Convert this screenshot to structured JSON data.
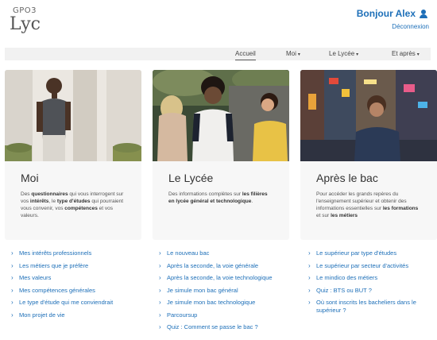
{
  "header": {
    "logo_small": "GPO3",
    "logo_big": "Lyc",
    "greeting": "Bonjour Alex",
    "logout": "Déconnexion"
  },
  "nav": {
    "items": [
      {
        "label": "Accueil",
        "caret": ""
      },
      {
        "label": "Moi",
        "caret": "▾"
      },
      {
        "label": "Le Lycée",
        "caret": "▾"
      },
      {
        "label": "Et après",
        "caret": "▾"
      }
    ]
  },
  "cards": [
    {
      "title": "Moi",
      "desc": [
        {
          "t": "Des ",
          "b": false
        },
        {
          "t": "questionnaires",
          "b": true
        },
        {
          "t": " qui vous interrogent sur vos ",
          "b": false
        },
        {
          "t": "intérêts",
          "b": true
        },
        {
          "t": ", le ",
          "b": false
        },
        {
          "t": "type d'études",
          "b": true
        },
        {
          "t": " qui pourraient vous convenir, vos ",
          "b": false
        },
        {
          "t": "compétences",
          "b": true
        },
        {
          "t": " et vos valeurs.",
          "b": false
        }
      ]
    },
    {
      "title": "Le Lycée",
      "desc": [
        {
          "t": "Des informations complètes sur ",
          "b": false
        },
        {
          "t": "les filières en lycée général et technologique",
          "b": true
        },
        {
          "t": ".",
          "b": false
        }
      ]
    },
    {
      "title": "Après le bac",
      "desc": [
        {
          "t": "Pour accéder les grands repères du l'enseignement supérieur et obtenir des informations essentielles sur ",
          "b": false
        },
        {
          "t": "les formations",
          "b": true
        },
        {
          "t": " et sur ",
          "b": false
        },
        {
          "t": "les métiers",
          "b": true
        }
      ]
    }
  ],
  "links": {
    "moi": [
      "Mes intérêts professionnels",
      "Les métiers que je préfère",
      "Mes valeurs",
      "Mes compétences générales",
      "Le type d'étude qui me conviendrait",
      "Mon projet de vie"
    ],
    "lycee": [
      "Le nouveau bac",
      "Après la seconde, la voie générale",
      "Après la seconde, la voie technologique",
      "Je simule mon bac général",
      "Je simule mon bac technologique",
      "Parcoursup",
      "Quiz : Comment se passe le bac ?"
    ],
    "apres": [
      "Le supérieur par type d'études",
      "Le supérieur par secteur d'activités",
      "Le mindico des métiers",
      "Quiz : BTS ou BUT ?",
      "Où sont inscrits les bacheliers dans le supérieur ?"
    ]
  },
  "icons": {
    "link_chevron": "chevron-right-icon",
    "user": "user-icon"
  },
  "colors": {
    "accent": "#1d6fb8",
    "nav_bg": "#f1f1f1",
    "card_bg": "#f7f7f7"
  }
}
